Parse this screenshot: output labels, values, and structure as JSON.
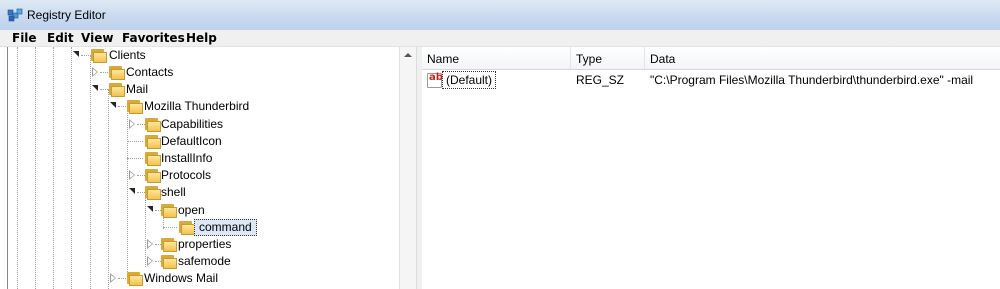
{
  "window": {
    "title": "Registry Editor"
  },
  "menu": [
    "File",
    "Edit",
    "View",
    "Favorites",
    "Help"
  ],
  "tree": [
    {
      "label": "Clients",
      "expander": "open"
    },
    {
      "label": "Contacts",
      "expander": "closed"
    },
    {
      "label": "Mail",
      "expander": "open"
    },
    {
      "label": "Mozilla Thunderbird",
      "expander": "open"
    },
    {
      "label": "Capabilities",
      "expander": "closed"
    },
    {
      "label": "DefaultIcon",
      "expander": "none"
    },
    {
      "label": "InstallInfo",
      "expander": "none"
    },
    {
      "label": "Protocols",
      "expander": "closed"
    },
    {
      "label": "shell",
      "expander": "open"
    },
    {
      "label": "open",
      "expander": "open"
    },
    {
      "label": "command",
      "expander": "none",
      "selected": true
    },
    {
      "label": "properties",
      "expander": "closed"
    },
    {
      "label": "safemode",
      "expander": "closed"
    },
    {
      "label": "Windows Mail",
      "expander": "closed"
    }
  ],
  "list": {
    "columns": [
      "Name",
      "Type",
      "Data"
    ],
    "rows": [
      {
        "icon": "string-value-icon",
        "icon_text": "ab",
        "name": "(Default)",
        "type": "REG_SZ",
        "data": "\"C:\\Program Files\\Mozilla Thunderbird\\thunderbird.exe\" -mail"
      }
    ]
  }
}
